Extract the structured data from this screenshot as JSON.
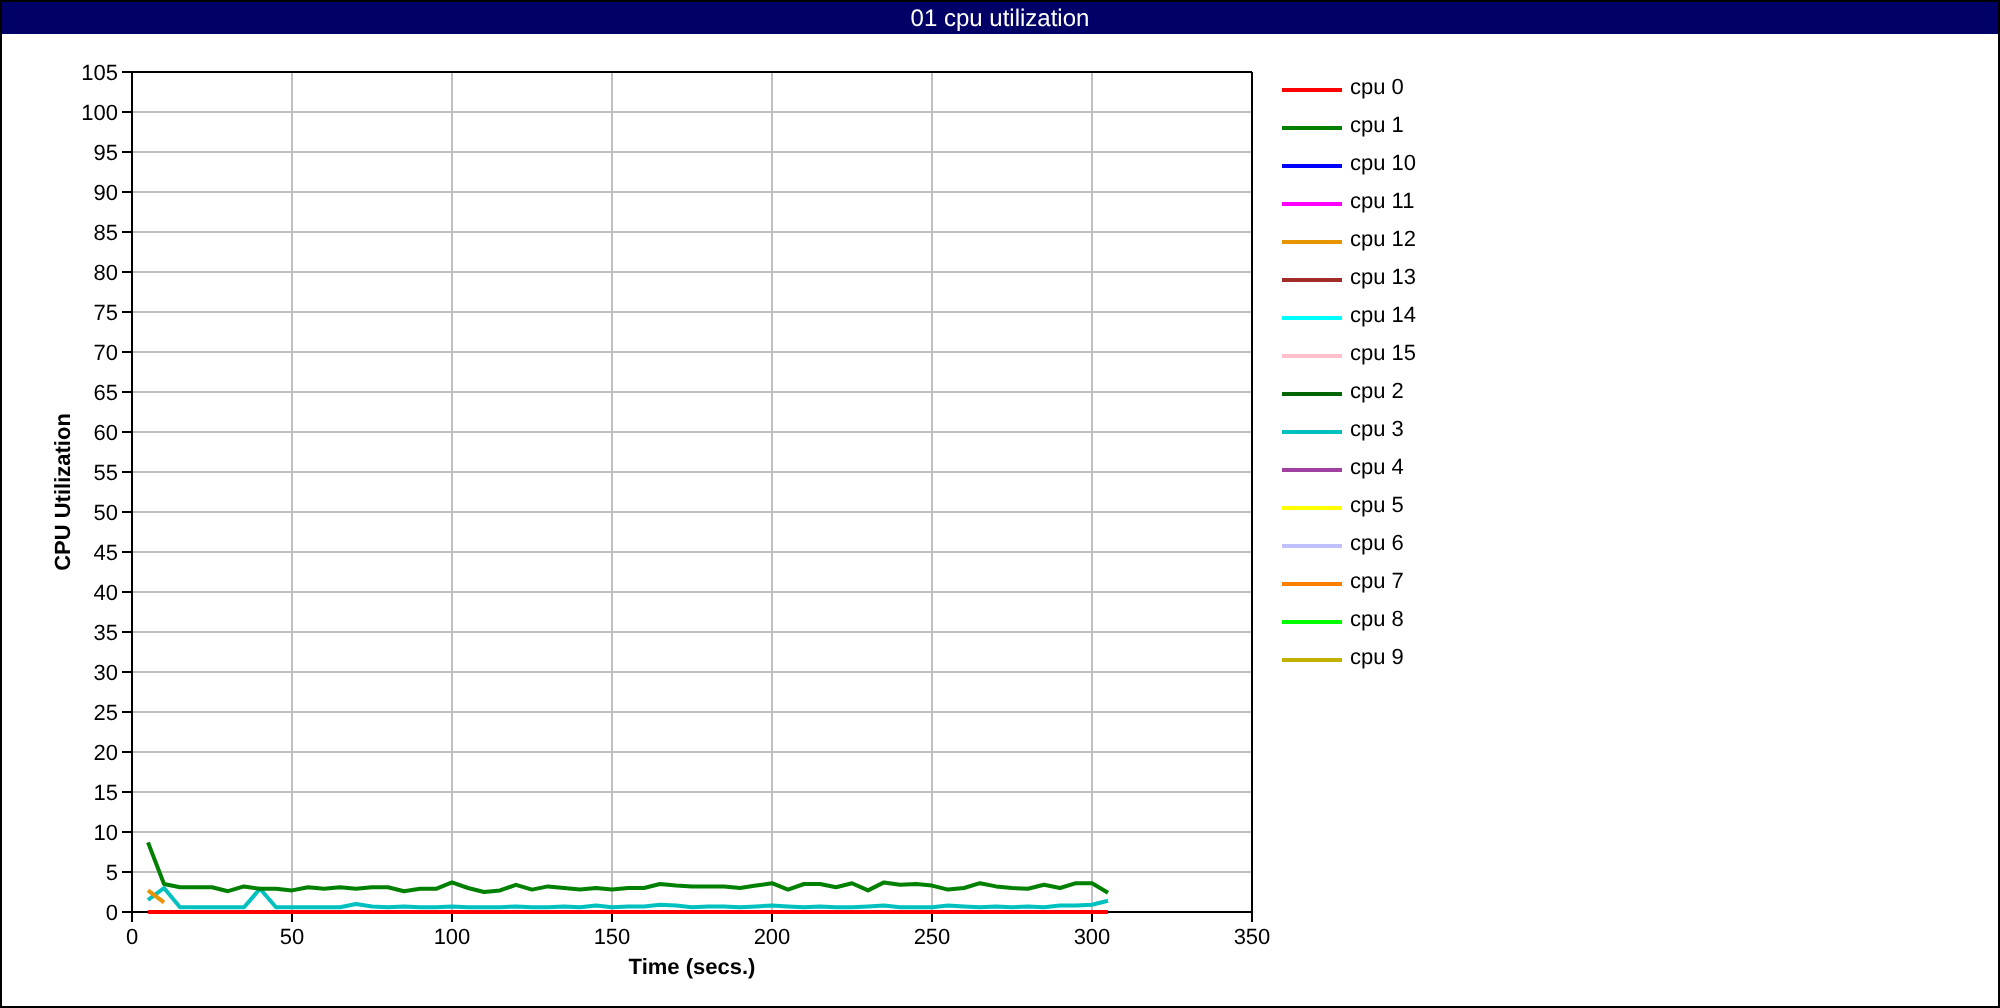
{
  "window": {
    "title": "01 cpu utilization"
  },
  "chart_data": {
    "type": "line",
    "grid": true,
    "xlabel": "Time (secs.)",
    "ylabel": "CPU Utilization",
    "xlim": [
      0,
      350
    ],
    "ylim": [
      0,
      105
    ],
    "xticks": [
      0,
      50,
      100,
      150,
      200,
      250,
      300,
      350
    ],
    "yticks": [
      0,
      5,
      10,
      15,
      20,
      25,
      30,
      35,
      40,
      45,
      50,
      55,
      60,
      65,
      70,
      75,
      80,
      85,
      90,
      95,
      100,
      105
    ],
    "x": [
      5,
      10,
      15,
      20,
      25,
      30,
      35,
      40,
      45,
      50,
      55,
      60,
      65,
      70,
      75,
      80,
      85,
      90,
      95,
      100,
      105,
      110,
      115,
      120,
      125,
      130,
      135,
      140,
      145,
      150,
      155,
      160,
      165,
      170,
      175,
      180,
      185,
      190,
      195,
      200,
      205,
      210,
      215,
      220,
      225,
      230,
      235,
      240,
      245,
      250,
      255,
      260,
      265,
      270,
      275,
      280,
      285,
      290,
      295,
      300,
      305
    ],
    "series": [
      {
        "name": "cpu 0",
        "color": "#ff0000",
        "values": [
          0,
          0,
          0,
          0,
          0,
          0,
          0,
          0,
          0,
          0,
          0,
          0,
          0,
          0,
          0,
          0,
          0,
          0,
          0,
          0,
          0,
          0,
          0,
          0,
          0,
          0,
          0,
          0,
          0,
          0,
          0,
          0,
          0,
          0,
          0,
          0,
          0,
          0,
          0,
          0,
          0,
          0,
          0,
          0,
          0,
          0,
          0,
          0,
          0,
          0,
          0,
          0,
          0,
          0,
          0,
          0,
          0,
          0,
          0,
          0,
          0
        ]
      },
      {
        "name": "cpu 1",
        "color": "#008000",
        "values": [
          8.7,
          3.5,
          3.1,
          3.1,
          3.1,
          2.6,
          3.2,
          2.9,
          2.9,
          2.7,
          3.1,
          2.9,
          3.1,
          2.9,
          3.1,
          3.1,
          2.6,
          2.9,
          2.9,
          3.7,
          3.0,
          2.5,
          2.7,
          3.4,
          2.8,
          3.2,
          3.0,
          2.8,
          3.0,
          2.8,
          3.0,
          3.0,
          3.5,
          3.3,
          3.2,
          3.2,
          3.2,
          3.0,
          3.3,
          3.6,
          2.8,
          3.5,
          3.5,
          3.1,
          3.6,
          2.7,
          3.7,
          3.4,
          3.5,
          3.3,
          2.8,
          3.0,
          3.6,
          3.2,
          3.0,
          2.9,
          3.4,
          3.0,
          3.6,
          3.6,
          2.4
        ]
      },
      {
        "name": "cpu 10",
        "color": "#0000ff",
        "values": [
          null,
          null,
          null,
          null,
          null,
          null,
          null,
          null,
          null,
          null,
          null,
          null,
          null,
          null,
          null,
          null,
          null,
          null,
          null,
          null,
          null,
          null,
          null,
          null,
          null,
          null,
          null,
          null,
          null,
          null,
          null,
          null,
          null,
          null,
          null,
          null,
          null,
          null,
          null,
          null,
          null,
          null,
          null,
          null,
          null,
          null,
          null,
          null,
          null,
          null,
          null,
          null,
          null,
          null,
          null,
          null,
          null,
          null,
          null,
          null,
          null
        ]
      },
      {
        "name": "cpu 11",
        "color": "#ff00ff",
        "values": [
          null,
          null,
          null,
          null,
          null,
          null,
          null,
          null,
          null,
          null,
          null,
          null,
          null,
          null,
          null,
          null,
          null,
          null,
          null,
          null,
          null,
          null,
          null,
          null,
          null,
          null,
          null,
          null,
          null,
          null,
          null,
          null,
          null,
          null,
          null,
          null,
          null,
          null,
          null,
          null,
          null,
          null,
          null,
          null,
          null,
          null,
          null,
          null,
          null,
          null,
          null,
          null,
          null,
          null,
          null,
          null,
          null,
          null,
          null,
          null,
          null
        ]
      },
      {
        "name": "cpu 12",
        "color": "#e69500",
        "values": [
          2.7,
          1.2,
          null,
          null,
          null,
          null,
          null,
          null,
          null,
          null,
          null,
          null,
          null,
          null,
          null,
          null,
          null,
          null,
          null,
          null,
          null,
          null,
          null,
          null,
          null,
          null,
          null,
          null,
          null,
          null,
          null,
          null,
          null,
          null,
          null,
          null,
          null,
          null,
          null,
          null,
          null,
          null,
          null,
          null,
          null,
          null,
          null,
          null,
          null,
          null,
          null,
          null,
          null,
          null,
          null,
          null,
          null,
          null,
          null,
          null,
          null
        ]
      },
      {
        "name": "cpu 13",
        "color": "#a52a2a",
        "values": [
          null,
          null,
          null,
          null,
          null,
          null,
          null,
          null,
          null,
          null,
          null,
          null,
          null,
          null,
          null,
          null,
          null,
          null,
          null,
          null,
          null,
          null,
          null,
          null,
          null,
          null,
          null,
          null,
          null,
          null,
          null,
          null,
          null,
          null,
          null,
          null,
          null,
          null,
          null,
          null,
          null,
          null,
          null,
          null,
          null,
          null,
          null,
          null,
          null,
          null,
          null,
          null,
          null,
          null,
          null,
          null,
          null,
          null,
          null,
          null,
          null
        ]
      },
      {
        "name": "cpu 14",
        "color": "#00ffff",
        "values": [
          null,
          null,
          null,
          null,
          null,
          null,
          null,
          null,
          null,
          null,
          null,
          null,
          null,
          null,
          null,
          null,
          null,
          null,
          null,
          null,
          null,
          null,
          null,
          null,
          null,
          null,
          null,
          null,
          null,
          null,
          null,
          null,
          null,
          null,
          null,
          null,
          null,
          null,
          null,
          null,
          null,
          null,
          null,
          null,
          null,
          null,
          null,
          null,
          null,
          null,
          null,
          null,
          null,
          null,
          null,
          null,
          null,
          null,
          null,
          null,
          null
        ]
      },
      {
        "name": "cpu 15",
        "color": "#ffc0cb",
        "values": [
          null,
          null,
          null,
          null,
          null,
          null,
          null,
          null,
          null,
          null,
          null,
          null,
          null,
          null,
          null,
          null,
          null,
          null,
          null,
          null,
          null,
          null,
          null,
          null,
          null,
          null,
          null,
          null,
          null,
          null,
          null,
          null,
          null,
          null,
          null,
          null,
          null,
          null,
          null,
          null,
          null,
          null,
          null,
          null,
          null,
          null,
          null,
          null,
          null,
          null,
          null,
          null,
          null,
          null,
          null,
          null,
          null,
          null,
          null,
          null,
          null
        ]
      },
      {
        "name": "cpu 2",
        "color": "#006400",
        "values": [
          null,
          null,
          null,
          null,
          null,
          null,
          null,
          null,
          null,
          null,
          null,
          null,
          null,
          null,
          null,
          null,
          null,
          null,
          null,
          null,
          null,
          null,
          null,
          null,
          null,
          null,
          null,
          null,
          null,
          null,
          null,
          null,
          null,
          null,
          null,
          null,
          null,
          null,
          null,
          null,
          null,
          null,
          null,
          null,
          null,
          null,
          null,
          null,
          null,
          null,
          null,
          null,
          null,
          null,
          null,
          null,
          null,
          null,
          null,
          null,
          null
        ]
      },
      {
        "name": "cpu 3",
        "color": "#00c0c0",
        "values": [
          1.5,
          3.0,
          0.6,
          0.6,
          0.6,
          0.6,
          0.6,
          2.9,
          0.6,
          0.6,
          0.6,
          0.6,
          0.6,
          1.0,
          0.7,
          0.6,
          0.7,
          0.6,
          0.6,
          0.7,
          0.6,
          0.6,
          0.6,
          0.7,
          0.6,
          0.6,
          0.7,
          0.6,
          0.8,
          0.6,
          0.7,
          0.7,
          0.9,
          0.8,
          0.6,
          0.7,
          0.7,
          0.6,
          0.7,
          0.8,
          0.7,
          0.6,
          0.7,
          0.6,
          0.6,
          0.7,
          0.8,
          0.6,
          0.6,
          0.6,
          0.8,
          0.7,
          0.6,
          0.7,
          0.6,
          0.7,
          0.6,
          0.8,
          0.8,
          0.9,
          1.4
        ]
      },
      {
        "name": "cpu 4",
        "color": "#a040a0",
        "values": [
          null,
          null,
          null,
          null,
          null,
          null,
          null,
          null,
          null,
          null,
          null,
          null,
          null,
          null,
          null,
          null,
          null,
          null,
          null,
          null,
          null,
          null,
          null,
          null,
          null,
          null,
          null,
          null,
          null,
          null,
          null,
          null,
          null,
          null,
          null,
          null,
          null,
          null,
          null,
          null,
          null,
          null,
          null,
          null,
          null,
          null,
          null,
          null,
          null,
          null,
          null,
          null,
          null,
          null,
          null,
          null,
          null,
          null,
          null,
          null,
          null
        ]
      },
      {
        "name": "cpu 5",
        "color": "#ffff00",
        "values": [
          null,
          null,
          null,
          null,
          null,
          null,
          null,
          null,
          null,
          null,
          null,
          null,
          null,
          null,
          null,
          null,
          null,
          null,
          null,
          null,
          null,
          null,
          null,
          null,
          null,
          null,
          null,
          null,
          null,
          null,
          null,
          null,
          null,
          null,
          null,
          null,
          null,
          null,
          null,
          null,
          null,
          null,
          null,
          null,
          null,
          null,
          null,
          null,
          null,
          null,
          null,
          null,
          null,
          null,
          null,
          null,
          null,
          null,
          null,
          null,
          null
        ]
      },
      {
        "name": "cpu 6",
        "color": "#c0c0ff",
        "values": [
          null,
          null,
          null,
          null,
          null,
          null,
          null,
          null,
          null,
          null,
          null,
          null,
          null,
          null,
          null,
          null,
          null,
          null,
          null,
          null,
          null,
          null,
          null,
          null,
          null,
          null,
          null,
          null,
          null,
          null,
          null,
          null,
          null,
          null,
          null,
          null,
          null,
          null,
          null,
          null,
          null,
          null,
          null,
          null,
          null,
          null,
          null,
          null,
          null,
          null,
          null,
          null,
          null,
          null,
          null,
          null,
          null,
          null,
          null,
          null,
          null
        ]
      },
      {
        "name": "cpu 7",
        "color": "#ff8000",
        "values": [
          null,
          null,
          null,
          null,
          null,
          null,
          null,
          null,
          null,
          null,
          null,
          null,
          null,
          null,
          null,
          null,
          null,
          null,
          null,
          null,
          null,
          null,
          null,
          null,
          null,
          null,
          null,
          null,
          null,
          null,
          null,
          null,
          null,
          null,
          null,
          null,
          null,
          null,
          null,
          null,
          null,
          null,
          null,
          null,
          null,
          null,
          null,
          null,
          null,
          null,
          null,
          null,
          null,
          null,
          null,
          null,
          null,
          null,
          null,
          null,
          null
        ]
      },
      {
        "name": "cpu 8",
        "color": "#00ff00",
        "values": [
          null,
          null,
          null,
          null,
          null,
          null,
          null,
          null,
          null,
          null,
          null,
          null,
          null,
          null,
          null,
          null,
          null,
          null,
          null,
          null,
          null,
          null,
          null,
          null,
          null,
          null,
          null,
          null,
          null,
          null,
          null,
          null,
          null,
          null,
          null,
          null,
          null,
          null,
          null,
          null,
          null,
          null,
          null,
          null,
          null,
          null,
          null,
          null,
          null,
          null,
          null,
          null,
          null,
          null,
          null,
          null,
          null,
          null,
          null,
          null,
          null
        ]
      },
      {
        "name": "cpu 9",
        "color": "#c0b000",
        "values": [
          null,
          null,
          null,
          null,
          null,
          null,
          null,
          null,
          null,
          null,
          null,
          null,
          null,
          null,
          null,
          null,
          null,
          null,
          null,
          null,
          null,
          null,
          null,
          null,
          null,
          null,
          null,
          null,
          null,
          null,
          null,
          null,
          null,
          null,
          null,
          null,
          null,
          null,
          null,
          null,
          null,
          null,
          null,
          null,
          null,
          null,
          null,
          null,
          null,
          null,
          null,
          null,
          null,
          null,
          null,
          null,
          null,
          null,
          null,
          null,
          null
        ]
      }
    ]
  }
}
